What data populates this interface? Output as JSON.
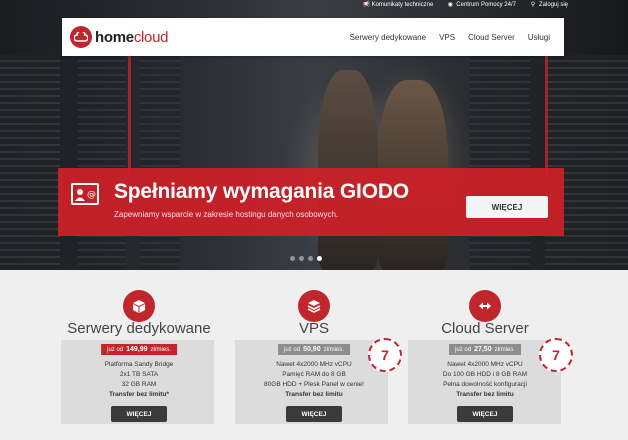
{
  "topbar": {
    "items": [
      {
        "icon": "megaphone-icon",
        "label": "Komunikaty techniczne"
      },
      {
        "icon": "globe-icon",
        "label": "Centrum Pomocy 24/7"
      },
      {
        "icon": "key-icon",
        "label": "Zaloguj się"
      }
    ]
  },
  "logo": {
    "home": "home",
    "cloud": "cloud"
  },
  "nav": {
    "items": [
      "Serwery dedykowane",
      "VPS",
      "Cloud Server",
      "Usługi"
    ]
  },
  "banner": {
    "title": "Spełniamy wymagania GIODO",
    "subtitle": "Zapewniamy wsparcie w zakresie hostingu danych osobowych.",
    "button": "WIĘCEJ",
    "slides_count": 4,
    "active_slide": 4
  },
  "products": [
    {
      "title": "Serwery dedykowane",
      "price_prefix": "już od",
      "price": "149,99",
      "price_suffix": "zł/mies.",
      "features": [
        "Platforma Sandy Bridge",
        "2x1 TB SATA",
        "32 GB RAM"
      ],
      "highlight": "Transfer bez limitu*",
      "button": "WIĘCEJ",
      "icon": "cube-icon"
    },
    {
      "title": "VPS",
      "price_prefix": "już od",
      "price": "50,90",
      "price_suffix": "zł/mies.",
      "features": [
        "Nawet 4x2000 MHz vCPU",
        "Pamięć RAM do 8 GB",
        "80GB HDD + Plesk Panel w cenie!"
      ],
      "highlight": "Transfer bez limitu",
      "button": "WIĘCEJ",
      "icon": "layers-icon",
      "stamp": "7"
    },
    {
      "title": "Cloud Server",
      "price_prefix": "już od",
      "price": "27,50",
      "price_suffix": "zł/mies.",
      "features": [
        "Nawet 4x2000 MHz vCPU",
        "Do 100 GB HDD i 8 GB RAM",
        "Pełna dowolność konfiguracji"
      ],
      "highlight": "Transfer bez limitu",
      "button": "WIĘCEJ",
      "icon": "arrows-horizontal-icon",
      "stamp": "7"
    }
  ],
  "colors": {
    "accent": "#c0262c",
    "dark_button": "#3a3a3a"
  }
}
